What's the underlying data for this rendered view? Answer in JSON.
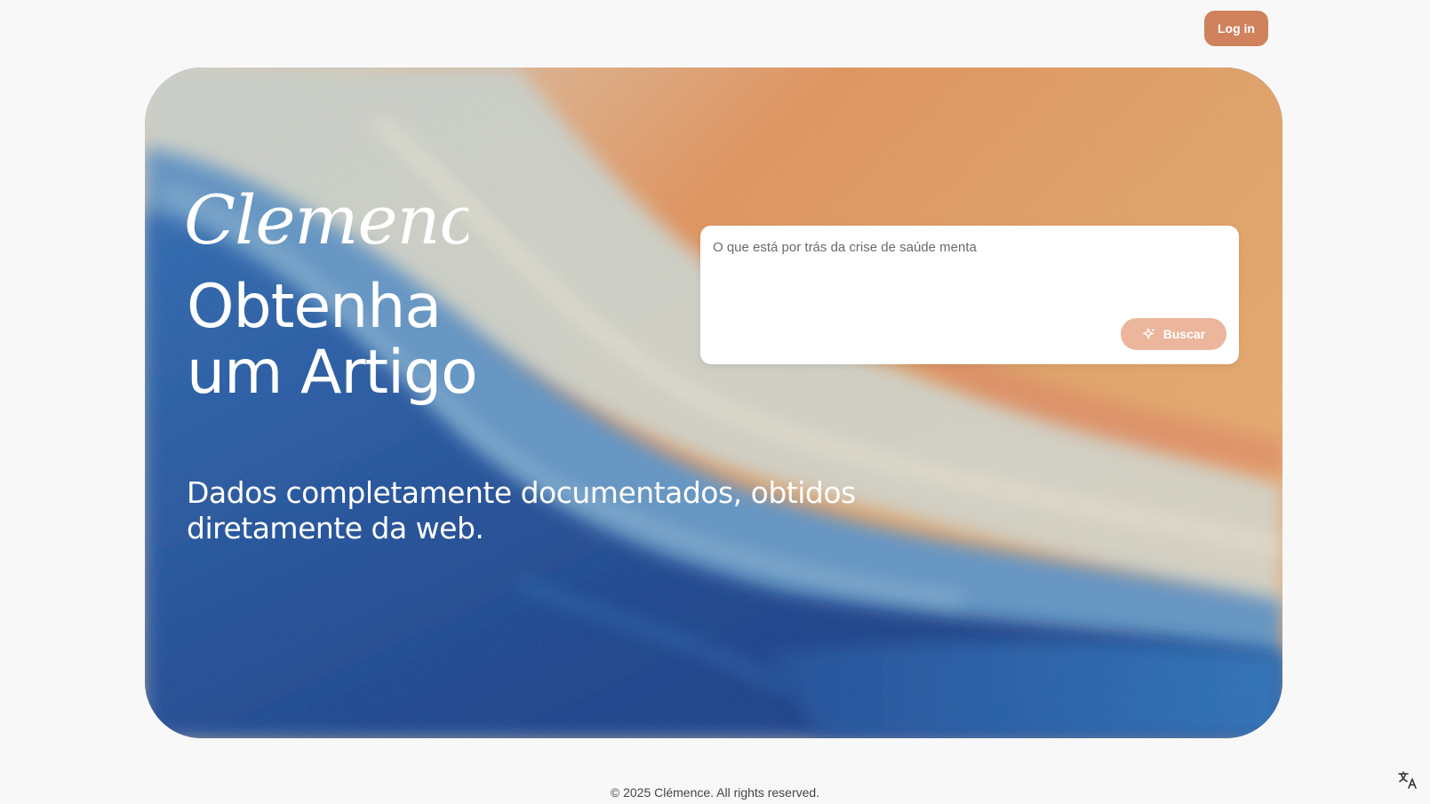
{
  "header": {
    "login_label": "Log in"
  },
  "hero": {
    "logo_text": "Clemence",
    "title_line1": "Obtenha",
    "title_line2": "um Artigo",
    "subtitle": "Dados completamente documentados, obtidos diretamente da web."
  },
  "search": {
    "placeholder": "O que está por trás da crise de saúde menta",
    "button_label": "Buscar",
    "button_icon": "sparkle-icon"
  },
  "footer": {
    "copyright": "© 2025 Clémence. All rights reserved."
  },
  "colors": {
    "accent": "#d0825c",
    "accent_light": "#ebb69c",
    "page_bg": "#f8f8f8"
  },
  "icons": {
    "translate": "translate-icon"
  }
}
